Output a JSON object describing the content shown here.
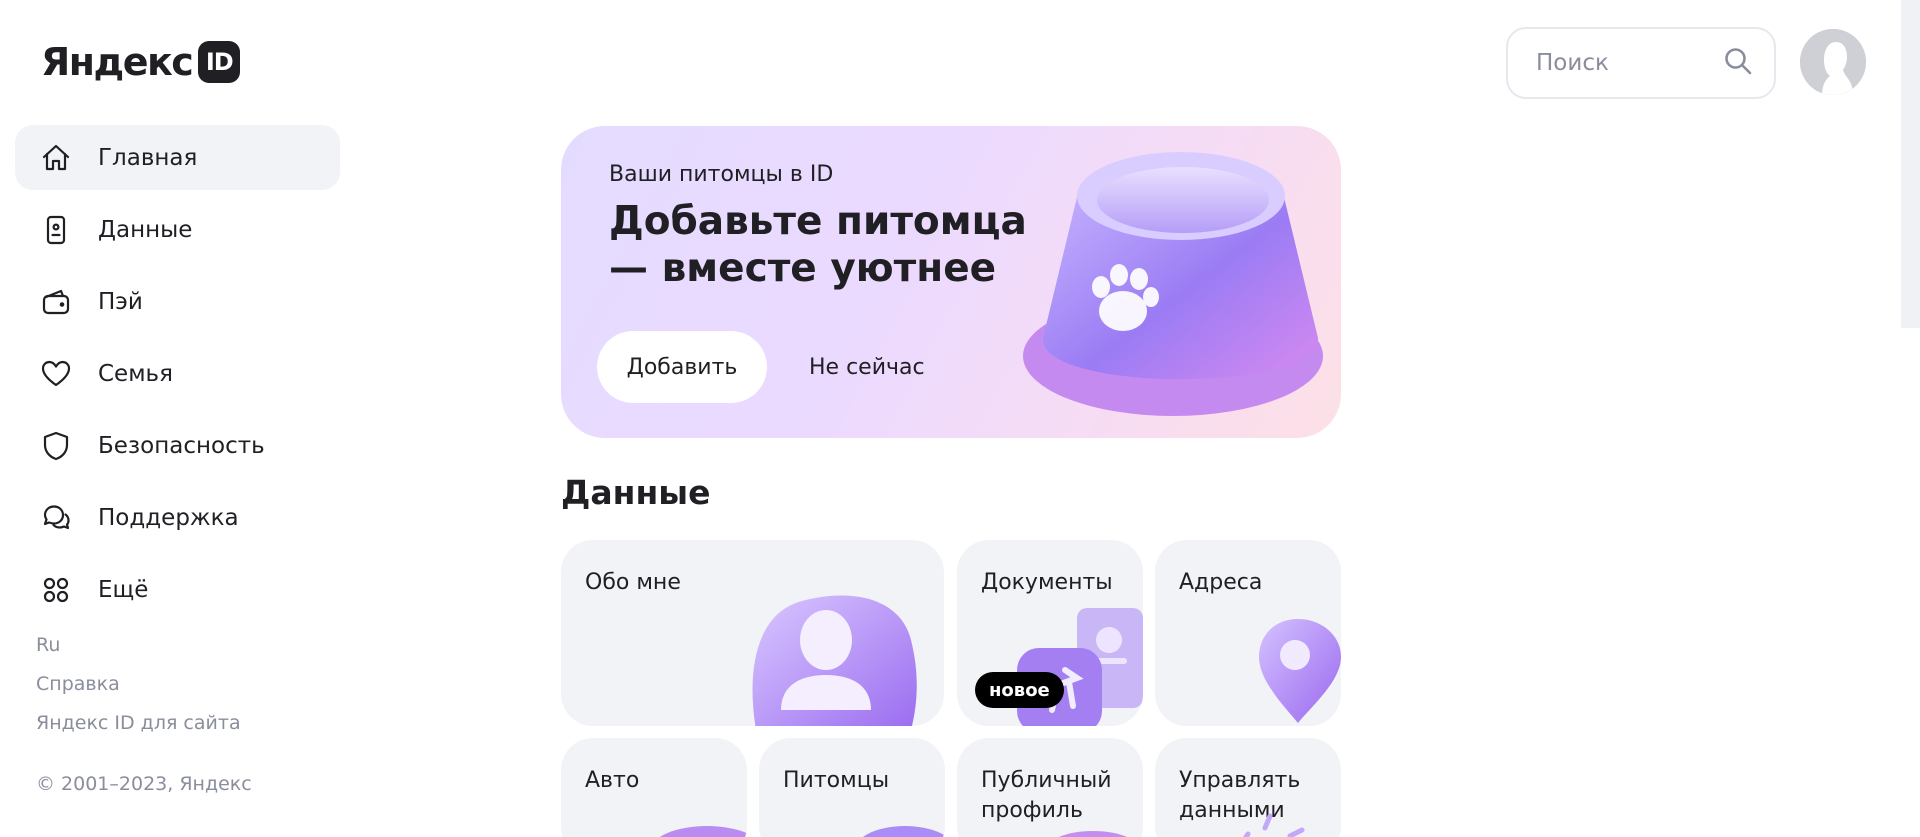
{
  "logo": {
    "text": "Яндекс",
    "badge": "ID"
  },
  "sidebar": {
    "items": [
      {
        "label": "Главная",
        "icon": "home-icon"
      },
      {
        "label": "Данные",
        "icon": "document-card-icon"
      },
      {
        "label": "Пэй",
        "icon": "wallet-icon"
      },
      {
        "label": "Семья",
        "icon": "heart-icon"
      },
      {
        "label": "Безопасность",
        "icon": "shield-icon"
      },
      {
        "label": "Поддержка",
        "icon": "chat-bubbles-icon"
      },
      {
        "label": "Ещё",
        "icon": "grid-icon"
      }
    ],
    "active_index": 0,
    "links": [
      "Ru",
      "Справка",
      "Яндекс ID для сайта"
    ],
    "copyright": "© 2001–2023, Яндекс"
  },
  "header": {
    "search": {
      "placeholder": "Поиск",
      "icon": "search-icon"
    },
    "avatar_icon": "user-silhouette-icon"
  },
  "banner": {
    "kicker": "Ваши питомцы в ID",
    "title": "Добавьте питомца — вместе уютнее",
    "primary_button": "Добавить",
    "secondary_button": "Не сейчас",
    "illustration": "pet-bowl-paw-icon"
  },
  "data_section": {
    "title": "Данные",
    "cards": [
      {
        "label": "Обо мне",
        "illustration": "person-icon"
      },
      {
        "label": "Документы",
        "illustration": "passport-plane-icon",
        "badge": "новое"
      },
      {
        "label": "Адреса",
        "illustration": "location-pin-icon"
      },
      {
        "label": "Авто",
        "illustration": "car-icon"
      },
      {
        "label": "Питомцы",
        "illustration": "pet-icon"
      },
      {
        "label": "Публичный профиль",
        "illustration": "profile-icon"
      },
      {
        "label": "Управлять данными",
        "illustration": "sparkle-icon"
      }
    ]
  },
  "colors": {
    "accent_purple": "#a98cf5",
    "active_nav_bg": "#f2f3f7",
    "muted_text": "#8a8d9c"
  }
}
